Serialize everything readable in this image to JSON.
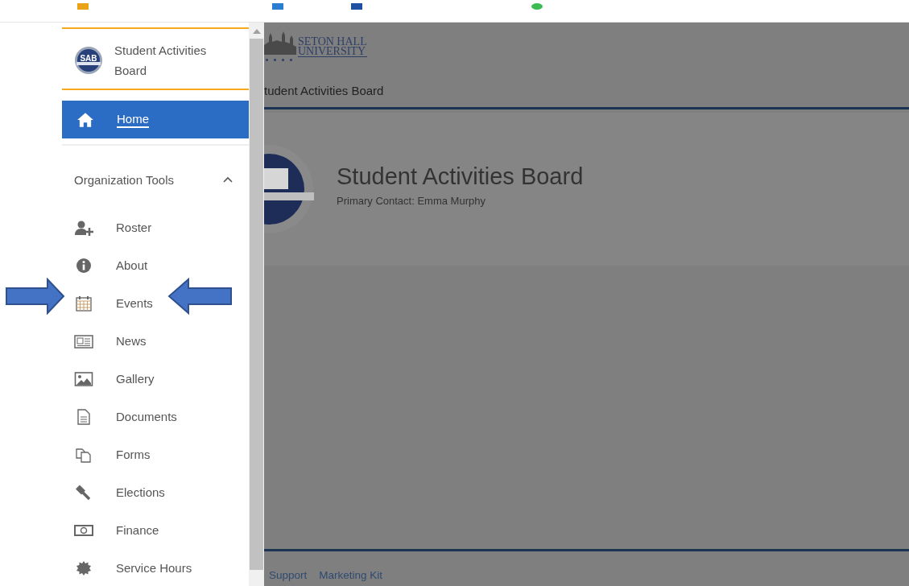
{
  "sidebar": {
    "org_name": "Student Activities Board",
    "logo_text": "SAB",
    "home": {
      "label": "Home",
      "selected": true
    },
    "section": {
      "label": "Organization Tools",
      "expanded": true
    },
    "items": [
      {
        "kind": "roster",
        "label": "Roster",
        "selected": false
      },
      {
        "kind": "about",
        "label": "About",
        "selected": false
      },
      {
        "kind": "events",
        "label": "Events",
        "selected": false
      },
      {
        "kind": "news",
        "label": "News",
        "selected": false
      },
      {
        "kind": "gallery",
        "label": "Gallery",
        "selected": false
      },
      {
        "kind": "documents",
        "label": "Documents",
        "selected": false
      },
      {
        "kind": "forms",
        "label": "Forms",
        "selected": false
      },
      {
        "kind": "elections",
        "label": "Elections",
        "selected": false
      },
      {
        "kind": "finance",
        "label": "Finance",
        "selected": false
      },
      {
        "kind": "service",
        "label": "Service Hours",
        "selected": false
      }
    ]
  },
  "header": {
    "university_line_1": "SETON HALL",
    "university_line_2": "UNIVERSITY",
    "org_title": "tudent Activities Board"
  },
  "profile": {
    "name": "Student Activities Board",
    "primary_contact": "Primary Contact: Emma Murphy"
  },
  "footer": {
    "links": [
      "Support",
      "Marketing Kit"
    ]
  }
}
